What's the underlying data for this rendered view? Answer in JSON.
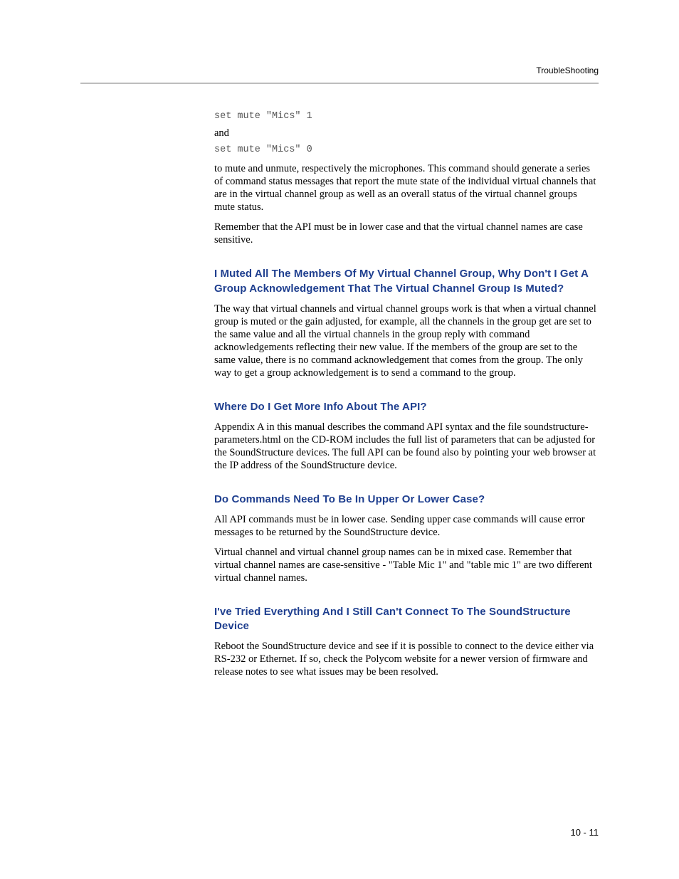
{
  "header": {
    "section": "TroubleShooting"
  },
  "body": {
    "code1": "set mute \"Mics\" 1",
    "and": "and",
    "code2": "set mute \"Mics\" 0",
    "p1": "to mute and unmute, respectively the microphones. This command should generate a series of command status messages that report the mute state of the individual virtual channels that are in the virtual channel group as well as an overall status of the virtual channel groups mute status.",
    "p2": "Remember that the API must be in lower case and that the virtual channel names are case sensitive.",
    "h1": "I Muted All The Members Of My Virtual Channel Group, Why Don't I Get A Group Acknowledgement That The Virtual Channel Group Is Muted?",
    "p3": "The way that virtual channels and virtual channel groups work is that when a virtual channel group is muted or the gain adjusted, for example, all the chan­nels in the group get are set to the same value and all the virtual channels in the group reply with command acknowledgements reflecting their new value. If the members of the group are set to the same value, there is no command acknowledgement that comes from the group. The only way to get a group acknowledgement is to send a command to the group.",
    "h2": "Where Do I Get More Info About The API?",
    "p4": "Appendix A in this manual describes the command API syntax and the file soundstructure-parameters.html on the CD-ROM includes the full list of parameters that can be adjusted for the SoundStructure devices. The full API can be found also by pointing your web browser at the IP address of the SoundStructure device.",
    "h3": "Do Commands Need To Be In Upper Or Lower Case?",
    "p5": "All API commands must be in lower case. Sending upper case commands will cause error messages to be returned by the SoundStructure device.",
    "p6": "Virtual channel and virtual channel group names can be in mixed case. Remember that virtual channel names are case-sensitive - \"Table Mic 1\" and \"table mic 1\" are two different virtual channel names.",
    "h4": "I've Tried Everything And I Still Can't Connect To The SoundStructure Device",
    "p7": "Reboot the SoundStructure device and see if it is possible to connect to the device either via RS-232 or Ethernet. If so, check the Polycom website for a newer version of firmware and release notes to see what issues may be been resolved."
  },
  "footer": {
    "page": "10 - 11"
  }
}
